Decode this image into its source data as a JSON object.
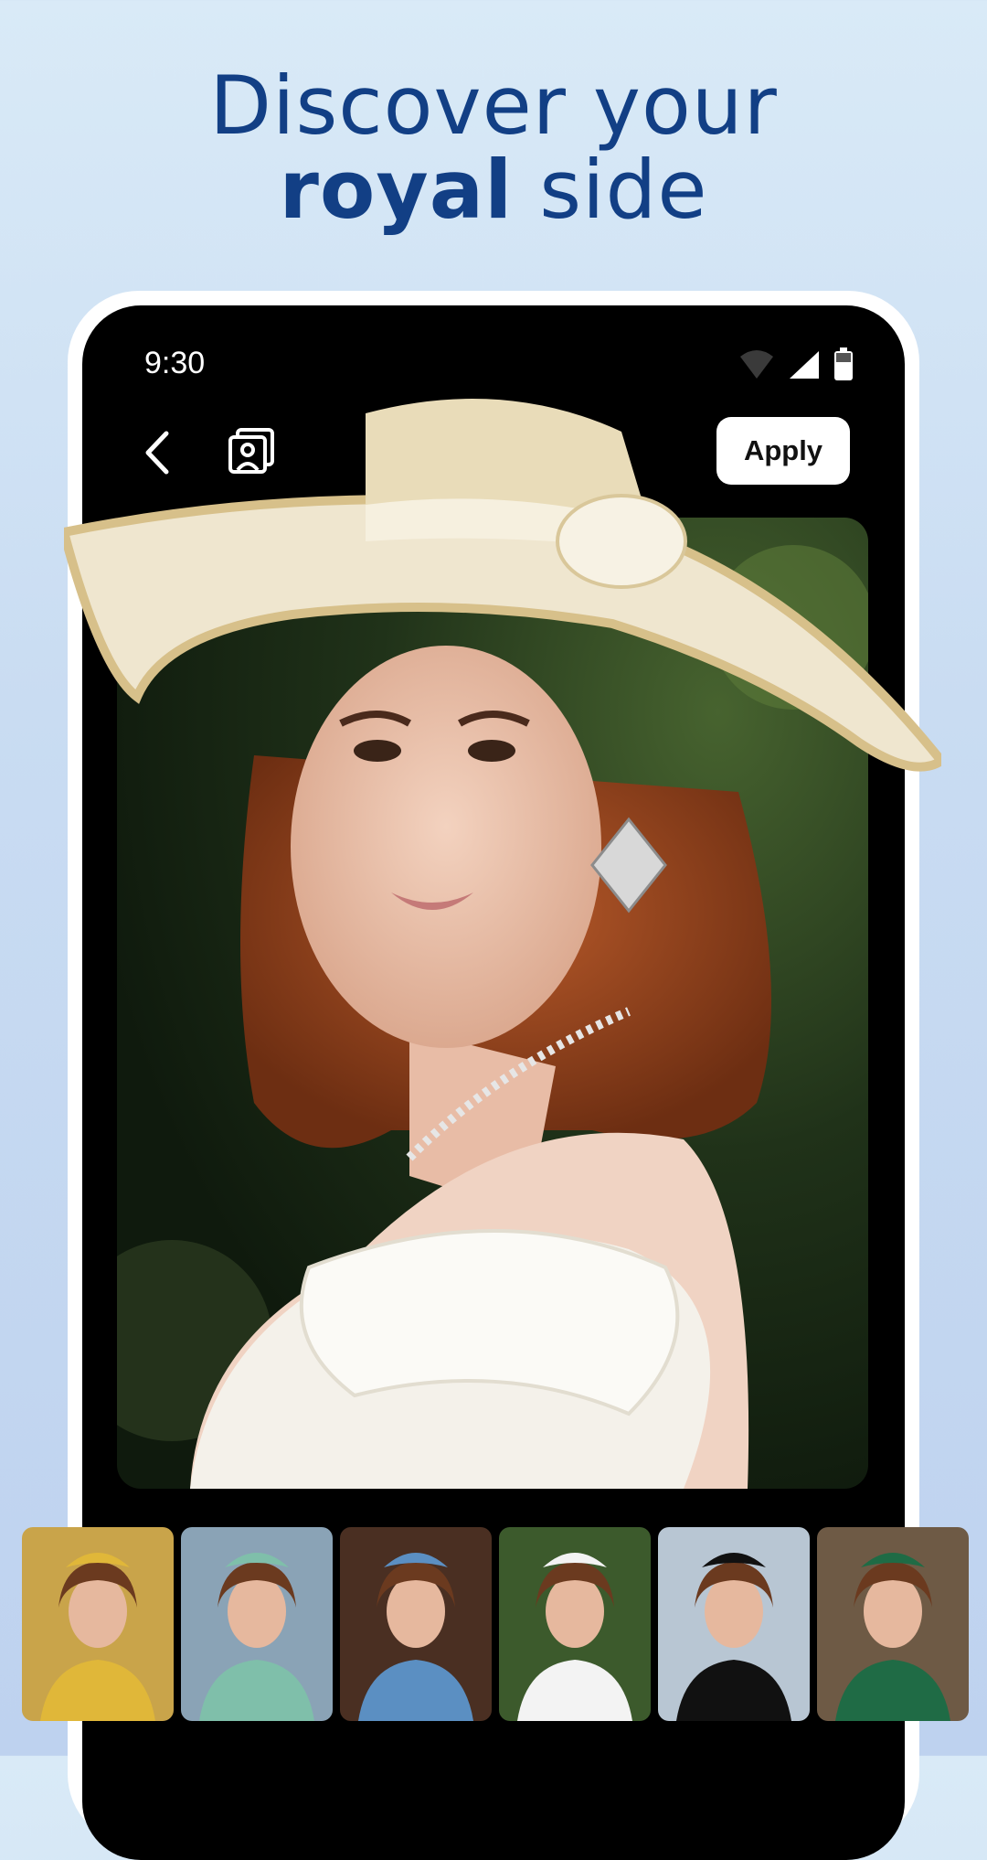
{
  "headline": {
    "line1": "Discover your",
    "line2_bold": "royal",
    "line2_rest": " side"
  },
  "status_bar": {
    "time": "9:30",
    "icons": [
      "wifi-icon",
      "signal-icon",
      "battery-icon"
    ]
  },
  "toolbar": {
    "back_icon": "chevron-left-icon",
    "gallery_icon": "portrait-gallery-icon",
    "apply_label": "Apply"
  },
  "preview": {
    "subject": "portrait-photo"
  },
  "styles": {
    "items": [
      {
        "name": "gold-gown-style",
        "bg": "#c9a44a",
        "accent": "#e0b739"
      },
      {
        "name": "teal-hat-style",
        "bg": "#8aa3b6",
        "accent": "#7fbfaa"
      },
      {
        "name": "blue-crown-style",
        "bg": "#4a2f22",
        "accent": "#5b8fc2"
      },
      {
        "name": "white-bonnet-style",
        "bg": "#3c5a2c",
        "accent": "#f3f3f3"
      },
      {
        "name": "black-beret-style",
        "bg": "#b8c6d3",
        "accent": "#111111"
      },
      {
        "name": "green-hat-style",
        "bg": "#6e5a45",
        "accent": "#1f6b45"
      }
    ]
  },
  "colors": {
    "headline": "#123f85",
    "background_top": "#d9eaf7",
    "background_bottom": "#bed2ef"
  }
}
